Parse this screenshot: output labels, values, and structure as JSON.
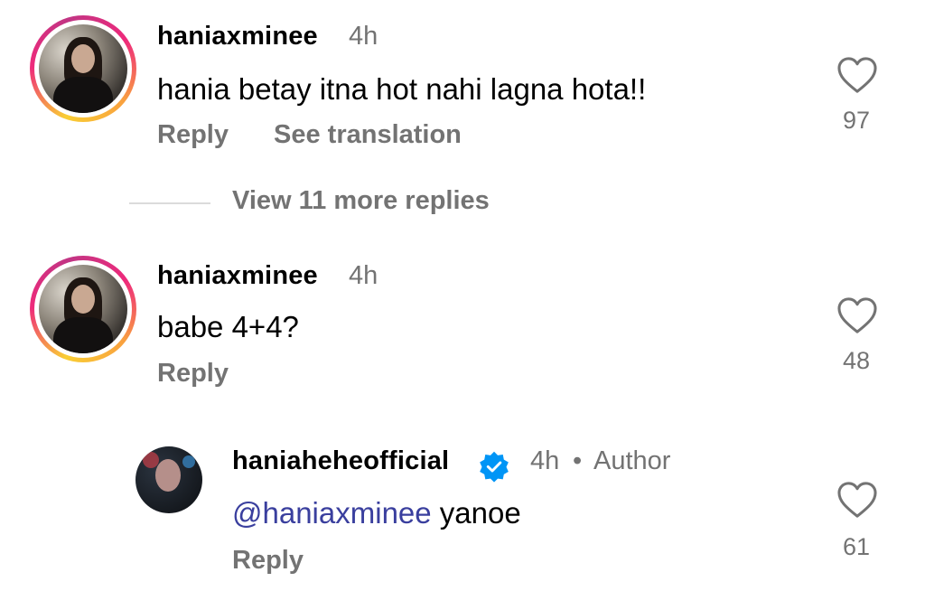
{
  "comments": [
    {
      "username": "haniaxminee",
      "time": "4h",
      "text": "hania betay itna hot nahi lagna hota!!",
      "reply_label": "Reply",
      "translate_label": "See translation",
      "likes": "97"
    },
    {
      "username": "haniaxminee",
      "time": "4h",
      "text": "babe 4+4?",
      "reply_label": "Reply",
      "likes": "48"
    }
  ],
  "view_replies_label": "View 11 more replies",
  "reply": {
    "username": "haniaheheofficial",
    "verified": true,
    "time": "4h",
    "separator": "•",
    "author_label": "Author",
    "mention": "@haniaxminee",
    "text": "yanoe",
    "reply_label": "Reply",
    "likes": "61"
  },
  "colors": {
    "secondary_text": "#737373",
    "mention": "#3a3f9e",
    "verified_badge": "#0095f6"
  }
}
